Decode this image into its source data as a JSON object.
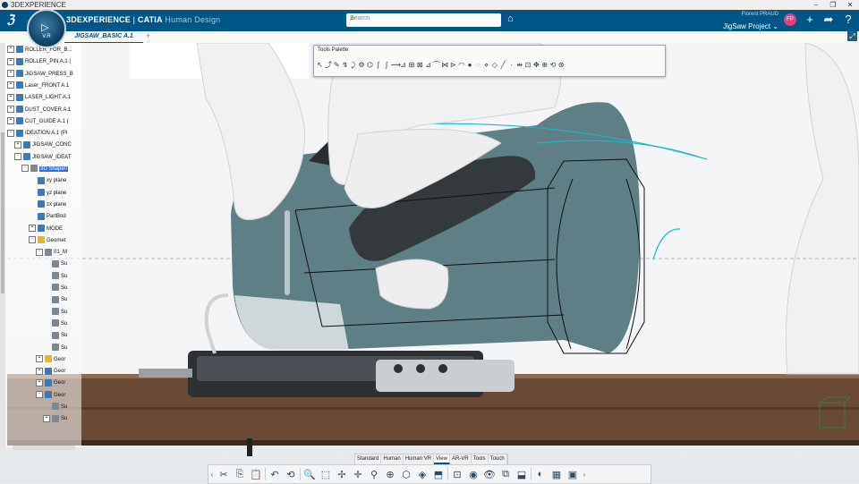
{
  "window": {
    "title": "3DEXPERIENCE",
    "controls": [
      "–",
      "❐",
      "✕"
    ]
  },
  "topbar": {
    "brand_3dx": "3DEXPERIENCE",
    "brand_sep": " | ",
    "brand_app": "CATIA",
    "brand_role": "Human Design",
    "compass_version": "V.R",
    "search_placeholder": "Search",
    "user_name": "Florent PRAUD",
    "project": "JigSaw Project",
    "avatar_initials": "FP",
    "icons": [
      "tag-icon",
      "add-icon",
      "share-icon",
      "help-icon"
    ]
  },
  "tabs": {
    "active": "JIGSAW_BASIC A.1",
    "add": "+"
  },
  "tree": {
    "items": [
      {
        "label": "ROLLER_FOR_B...",
        "indent": 1,
        "exp": "+",
        "icon": "blue"
      },
      {
        "label": "ROLLER_PIN A.1 (",
        "indent": 1,
        "exp": "+",
        "icon": "blue"
      },
      {
        "label": "JIGSAW_PRESS_B",
        "indent": 1,
        "exp": "+",
        "icon": "blue"
      },
      {
        "label": "Laser_FRONT A.1",
        "indent": 1,
        "exp": "+",
        "icon": "blue"
      },
      {
        "label": "LASER_LIGHT A.1",
        "indent": 1,
        "exp": "+",
        "icon": "blue"
      },
      {
        "label": "DUST_COVER A.1",
        "indent": 1,
        "exp": "+",
        "icon": "blue"
      },
      {
        "label": "CUT_GUIDE A.1 (",
        "indent": 1,
        "exp": "+",
        "icon": "blue"
      },
      {
        "label": "IDEATION A.1 (PI",
        "indent": 1,
        "exp": "-",
        "icon": "blue"
      },
      {
        "label": "JIGSAW_CONC",
        "indent": 2,
        "exp": "+",
        "icon": "blue"
      },
      {
        "label": "JIGSAW_IDEAT",
        "indent": 2,
        "exp": "-",
        "icon": "blue"
      },
      {
        "label": "3D Shape0",
        "indent": 3,
        "exp": "-",
        "icon": "gray",
        "selected": true
      },
      {
        "label": "xy plane",
        "indent": 4,
        "exp": "",
        "icon": "blue"
      },
      {
        "label": "yz plane",
        "indent": 4,
        "exp": "",
        "icon": "blue"
      },
      {
        "label": "zx plane",
        "indent": 4,
        "exp": "",
        "icon": "blue"
      },
      {
        "label": "PartBod",
        "indent": 4,
        "exp": "",
        "icon": "blue"
      },
      {
        "label": "MODE",
        "indent": 4,
        "exp": "+",
        "icon": "blue"
      },
      {
        "label": "Geomet",
        "indent": 4,
        "exp": "-",
        "icon": "yel"
      },
      {
        "label": "01_M",
        "indent": 5,
        "exp": "-",
        "icon": "gray"
      },
      {
        "label": "Su",
        "indent": 6,
        "exp": "",
        "icon": "gray"
      },
      {
        "label": "Su",
        "indent": 6,
        "exp": "",
        "icon": "gray"
      },
      {
        "label": "Su",
        "indent": 6,
        "exp": "",
        "icon": "gray"
      },
      {
        "label": "Su",
        "indent": 6,
        "exp": "",
        "icon": "gray"
      },
      {
        "label": "Su",
        "indent": 6,
        "exp": "",
        "icon": "gray"
      },
      {
        "label": "Su",
        "indent": 6,
        "exp": "",
        "icon": "gray"
      },
      {
        "label": "Su",
        "indent": 6,
        "exp": "",
        "icon": "gray"
      },
      {
        "label": "Su",
        "indent": 6,
        "exp": "",
        "icon": "gray"
      },
      {
        "label": "Geor",
        "indent": 5,
        "exp": "+",
        "icon": "yel"
      },
      {
        "label": "Geor",
        "indent": 5,
        "exp": "+",
        "icon": "blue"
      },
      {
        "label": "Geor",
        "indent": 5,
        "exp": "+",
        "icon": "blue"
      },
      {
        "label": "Geor",
        "indent": 5,
        "exp": "-",
        "icon": "blue"
      },
      {
        "label": "Su",
        "indent": 6,
        "exp": "",
        "icon": "gray"
      },
      {
        "label": "Su",
        "indent": 6,
        "exp": "+",
        "icon": "gray"
      }
    ]
  },
  "palette": {
    "title": "Tools Palette",
    "tools": [
      "↖",
      "⤴",
      "✎",
      "↯",
      "⤸",
      "⚙",
      "⌬",
      "ʃ",
      "∫",
      "⟿",
      "⊿",
      "⊞",
      "⊠",
      "⊿",
      "⌒",
      "⋈",
      "⊳",
      "◠",
      "●",
      "◌",
      "⋄",
      "◇",
      "╱",
      "·",
      "⇹",
      "⊡",
      "✥",
      "⊕",
      "⟲",
      "⊛"
    ]
  },
  "bottom": {
    "sections": [
      "Standard",
      "Human",
      "Human VR",
      "View",
      "AR-VR",
      "Tools",
      "Touch"
    ],
    "active_section": "View",
    "actions": [
      "✂",
      "⎘",
      "📋",
      "↶",
      "⟲",
      "🔍",
      "⬚",
      "✢",
      "✛",
      "⚲",
      "⊕",
      "⬡",
      "◈",
      "⬒",
      "⊡",
      "◉",
      "👁",
      "⧉",
      "⬓",
      "◐",
      "▦",
      "▣"
    ]
  },
  "colors": {
    "topbar": "#005686",
    "jigsaw_body": "#5e7f86",
    "table": "#6a4a35",
    "wire": "#1bb8c9"
  }
}
